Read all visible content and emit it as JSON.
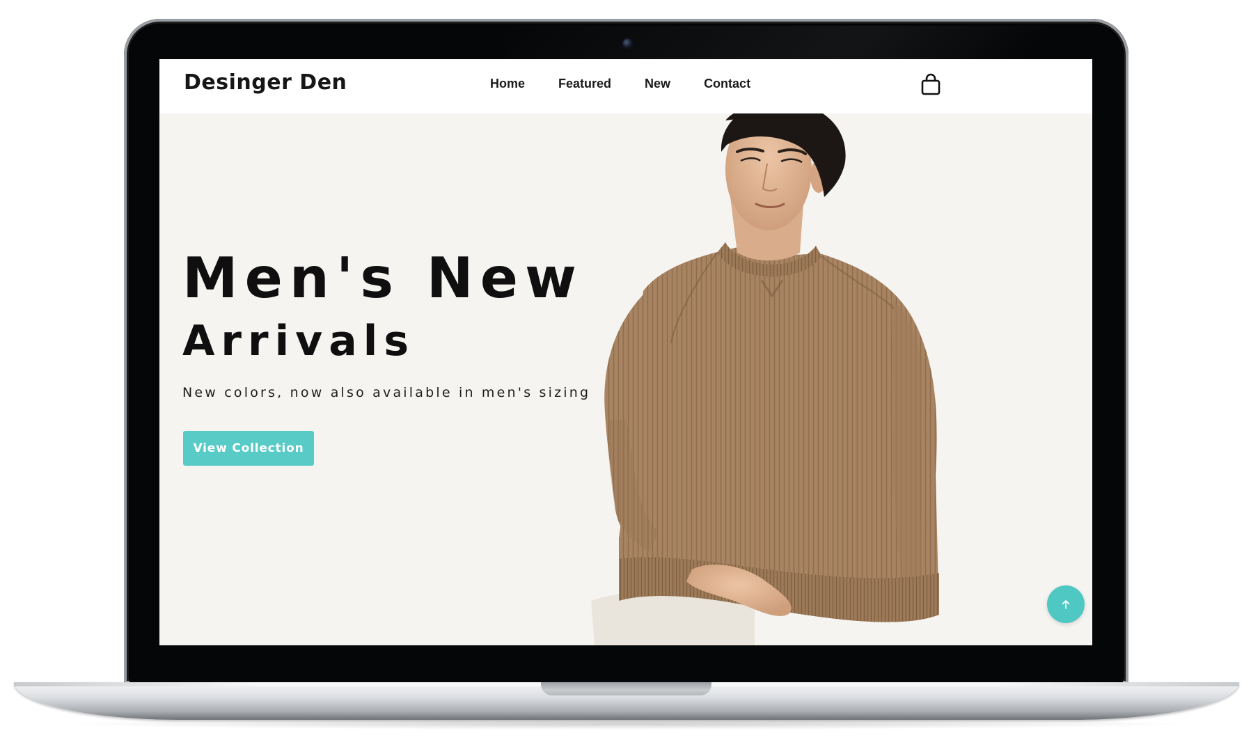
{
  "brand": "Desinger Den",
  "nav": {
    "items": [
      {
        "label": "Home"
      },
      {
        "label": "Featured"
      },
      {
        "label": "New"
      },
      {
        "label": "Contact"
      }
    ]
  },
  "header": {
    "cart_icon": "shopping-bag-icon"
  },
  "hero": {
    "title_line1": "Men's New",
    "title_line2": "Arrivals",
    "subtitle": "New colors, now also available in men's sizing",
    "cta_label": "View Collection",
    "image": "model-in-brown-knit-sweater"
  },
  "scroll_top": {
    "icon": "arrow-up-icon"
  },
  "colors": {
    "accent": "#58cbc7",
    "hero_background": "#f6f4f1",
    "text": "#0f0f0f",
    "sweater": "#a88462"
  }
}
